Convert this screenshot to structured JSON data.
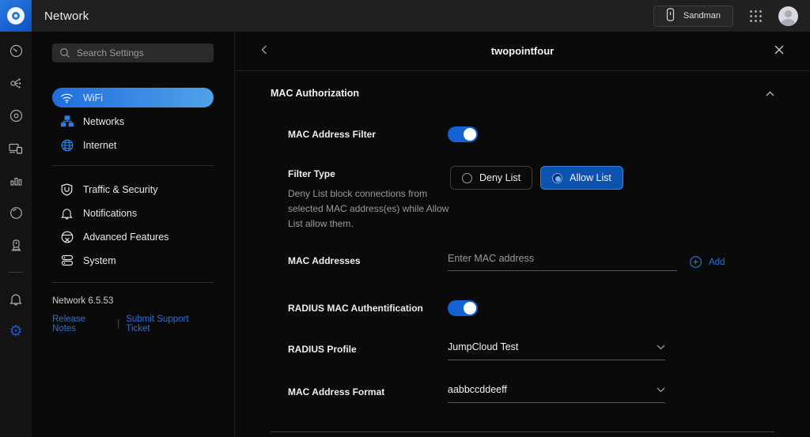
{
  "topbar": {
    "title": "Network",
    "console_name": "Sandman"
  },
  "sidebar": {
    "search_placeholder": "Search Settings",
    "items": [
      {
        "label": "WiFi",
        "icon": "wifi-icon",
        "active": true
      },
      {
        "label": "Networks",
        "icon": "networks-icon",
        "active": false
      },
      {
        "label": "Internet",
        "icon": "internet-icon",
        "active": false
      },
      {
        "label": "Traffic & Security",
        "icon": "shield-icon",
        "active": false
      },
      {
        "label": "Notifications",
        "icon": "bell-icon",
        "active": false
      },
      {
        "label": "Advanced Features",
        "icon": "advanced-features-icon",
        "active": false
      },
      {
        "label": "System",
        "icon": "system-icon",
        "active": false
      }
    ],
    "version": "Network 6.5.53",
    "links": {
      "release_notes": "Release Notes",
      "separator": "|",
      "submit_ticket": "Submit Support Ticket"
    }
  },
  "panel": {
    "title": "twopointfour",
    "section_title": "MAC Authorization",
    "rows": {
      "mac_filter": {
        "label": "MAC Address Filter",
        "enabled": true
      },
      "filter_type": {
        "label": "Filter Type",
        "description": "Deny List block connections from selected MAC address(es) while Allow List allow them.",
        "options": [
          {
            "label": "Deny List",
            "selected": false
          },
          {
            "label": "Allow List",
            "selected": true
          }
        ]
      },
      "mac_addresses": {
        "label": "MAC Addresses",
        "placeholder": "Enter MAC address",
        "add_label": "Add"
      },
      "radius_auth": {
        "label": "RADIUS MAC Authentification",
        "enabled": true
      },
      "radius_profile": {
        "label": "RADIUS Profile",
        "value": "JumpCloud Test"
      },
      "mac_format": {
        "label": "MAC Address Format",
        "value": "aabbccddeeff"
      }
    }
  },
  "icons": [
    "unifi-logo",
    "console-icon",
    "apps-grid-icon",
    "avatar",
    "search-icon",
    "dashboard-icon",
    "topology-icon",
    "devices-icon",
    "clients-icon",
    "insights-icon",
    "wifiman-icon",
    "camera-icon",
    "bell-icon",
    "settings-gear-icon",
    "wifi-icon",
    "networks-icon",
    "internet-icon",
    "shield-icon",
    "advanced-features-icon",
    "system-icon",
    "back-chevron-icon",
    "close-icon",
    "collapse-chevron-icon",
    "dropdown-chevron-icon",
    "add-plus-icon"
  ],
  "colors": {
    "accent_blue": "#2e6fd6",
    "toggle_on": "#1262d1",
    "selected_option_bg": "#0e52b0",
    "active_item_gradient_start": "#1e6ede",
    "active_item_gradient_end": "#4fa3e8",
    "logo_blue": "#1b63d4",
    "topbar_bg": "#202020",
    "panel_bg": "#0a0a0a"
  }
}
